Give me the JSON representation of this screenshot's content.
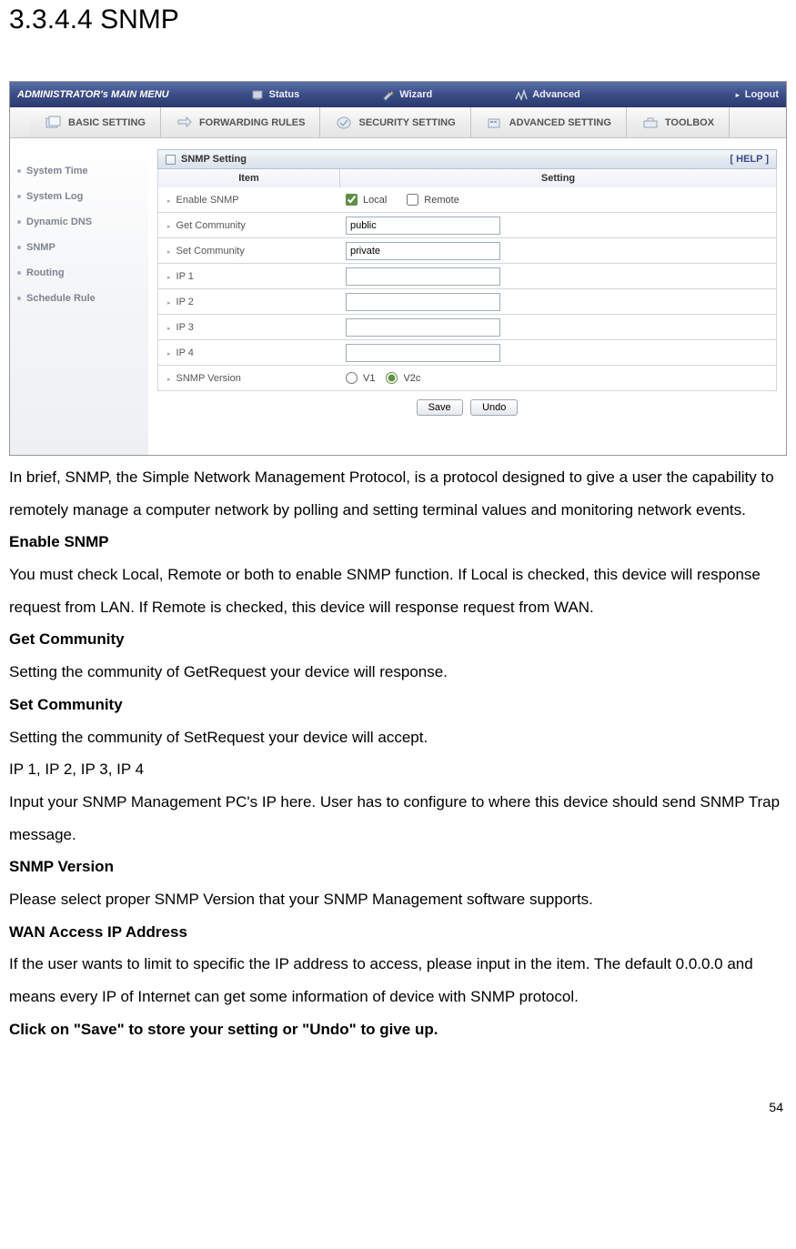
{
  "heading": "3.3.4.4 SNMP",
  "menu": {
    "title": "ADMINISTRATOR's MAIN MENU",
    "items": [
      "Status",
      "Wizard",
      "Advanced"
    ],
    "logout": "Logout"
  },
  "tabs": [
    "BASIC SETTING",
    "FORWARDING RULES",
    "SECURITY SETTING",
    "ADVANCED SETTING",
    "TOOLBOX"
  ],
  "sidebar": [
    "System Time",
    "System Log",
    "Dynamic DNS",
    "SNMP",
    "Routing",
    "Schedule Rule"
  ],
  "panel": {
    "title": "SNMP Setting",
    "help": "[ HELP ]",
    "col_item": "Item",
    "col_setting": "Setting",
    "rows": {
      "enable_snmp": "Enable SNMP",
      "get_community": "Get Community",
      "set_community": "Set Community",
      "ip1": "IP 1",
      "ip2": "IP 2",
      "ip3": "IP 3",
      "ip4": "IP 4",
      "snmp_version": "SNMP Version"
    },
    "values": {
      "local_checked": true,
      "remote_checked": false,
      "local_label": "Local",
      "remote_label": "Remote",
      "get_community_value": "public",
      "set_community_value": "private",
      "ip1": "",
      "ip2": "",
      "ip3": "",
      "ip4": "",
      "v1_label": "V1",
      "v2c_label": "V2c"
    },
    "save": "Save",
    "undo": "Undo"
  },
  "prose": {
    "p1": "In brief, SNMP, the Simple Network Management Protocol, is a protocol designed to give a user the capability to remotely manage a computer network by polling and setting terminal values and monitoring network events.",
    "h_enable": "Enable SNMP",
    "p_enable": "You must check Local, Remote or both to enable SNMP function. If Local is checked, this device will response request from LAN. If Remote is checked, this device will response request from WAN.",
    "h_get": "Get Community",
    "p_get": "Setting the community of GetRequest your device will response.",
    "h_set": "Set Community",
    "p_set": "Setting the community of SetRequest your device will accept.",
    "p_ips": "IP 1, IP 2, IP 3, IP 4",
    "p_ips_desc": "Input your SNMP Management PC's IP here. User has to configure to where this device should send SNMP Trap message.",
    "h_ver": "SNMP Version",
    "p_ver": "Please select proper SNMP Version that your SNMP Management software supports.",
    "h_wan": "WAN Access IP Address",
    "p_wan": "If the user wants to limit to specific the IP address to access, please input in the item. The default 0.0.0.0 and means every IP of Internet can get some information of device with SNMP protocol.",
    "p_save": "Click on \"Save\" to store your setting or \"Undo\" to give up."
  },
  "page_number": "54"
}
